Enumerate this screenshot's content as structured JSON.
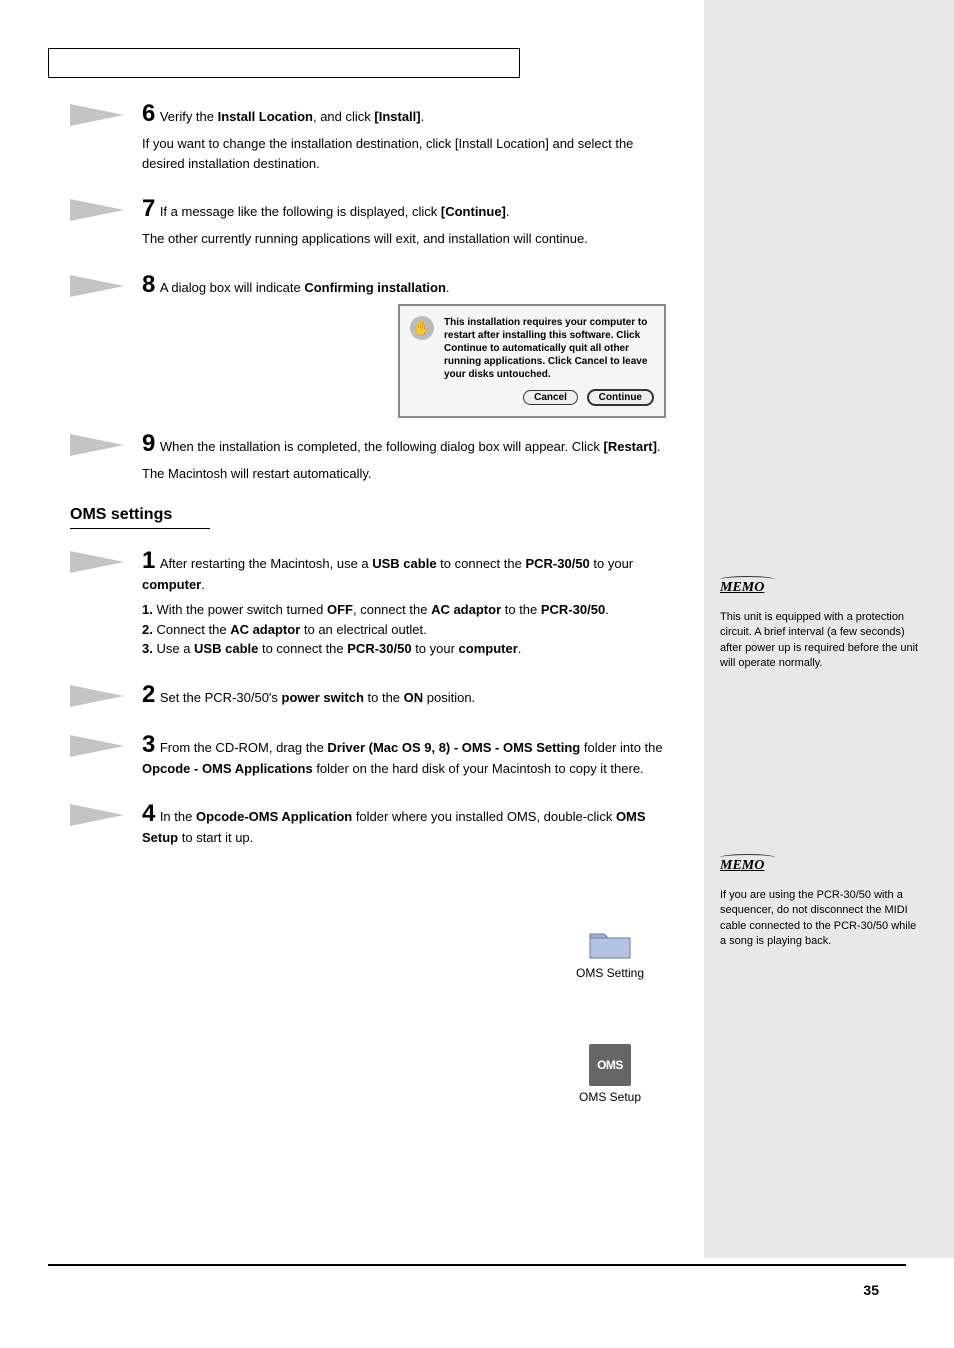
{
  "steps": {
    "s6": {
      "num": "6",
      "lead": "Verify the ",
      "bold1": "Install Location",
      "after1": ", and click ",
      "bold2": "[Install]",
      "after2": ".",
      "desc": "If you want to change the installation destination, click [Install Location] and select the desired installation destination."
    },
    "s7": {
      "num": "7",
      "lead": "If a message like the following is displayed, click ",
      "bold1": "[Continue]",
      "after1": ".",
      "desc": "The other currently running applications will exit, and installation will continue."
    },
    "s8": {
      "num": "8",
      "lead": "A dialog box will indicate ",
      "bold1": "Confirming installation",
      "after1": "."
    },
    "s9": {
      "num": "9",
      "lead": "When the installation is completed, the following dialog box will appear. Click ",
      "bold1": "[Restart]",
      "after1": ".",
      "desc": "The Macintosh will restart automatically."
    },
    "s1b": {
      "num": "1",
      "lead": "After restarting the Macintosh, use a ",
      "bold1": "USB cable",
      "after1": " to connect the ",
      "bold2": "PCR-30/50",
      "after2": " to your ",
      "bold3": "computer",
      "after3": ".",
      "desc1_pre": "With the power switch turned ",
      "desc1_b1": "OFF",
      "desc1_mid": ", connect the ",
      "desc1_b2": "AC adaptor",
      "desc1_mid2": " to the ",
      "desc1_b3": "PCR-30/50",
      "desc1_after": ".",
      "desc2_pre": "Connect the ",
      "desc2_b1": "AC adaptor",
      "desc2_mid": " to an electrical outlet.",
      "desc3_pre": "Use a ",
      "desc3_b1": "USB cable",
      "desc3_mid": " to connect the ",
      "desc3_b2": "PCR-30/50",
      "desc3_mid2": " to your ",
      "desc3_b3": "computer",
      "desc3_after": "."
    },
    "s2b": {
      "num": "2",
      "lead": "Set the PCR-30/50's ",
      "bold1": "power switch",
      "after1": " to the ",
      "bold2": "ON",
      "after2": " position."
    },
    "s3b": {
      "num": "3",
      "lead": "From the CD-ROM, drag the ",
      "bold1": "Driver (Mac OS 9, 8) - OMS - OMS Setting",
      "after1": " folder into the ",
      "bold2": "Opcode - OMS Applications",
      "after2": " folder on the hard disk of your Macintosh to copy it there."
    },
    "s4b": {
      "num": "4",
      "lead": "In the ",
      "bold1": "Opcode-OMS Application",
      "after1": " folder where you installed OMS, double-click ",
      "bold2": "OMS Setup",
      "after2": " to start it up."
    }
  },
  "dialog": {
    "text": "This installation requires your computer to restart after installing this software. Click Continue to automatically quit all other running applications. Click Cancel to leave your disks untouched.",
    "cancel": "Cancel",
    "continue": "Continue"
  },
  "section_heading": "OMS settings",
  "folder_label": "OMS Setting",
  "oms_box_text": "OMS",
  "oms_setup_label": "OMS Setup",
  "memo_label": "MEMO",
  "memo1": "This unit is equipped with a protection circuit. A brief interval (a few seconds) after power up is required before the unit will operate normally.",
  "memo2": "If you are using the PCR-30/50 with a sequencer, do not disconnect the MIDI cable connected to the PCR-30/50 while a song is playing back.",
  "page_number": "35"
}
